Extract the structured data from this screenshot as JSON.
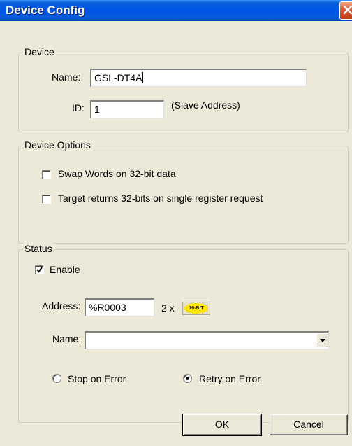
{
  "window": {
    "title": "Device Config"
  },
  "device": {
    "legend": "Device",
    "name_label": "Name:",
    "name_value": "GSL-DT4A",
    "id_label": "ID:",
    "id_value": "1",
    "id_hint": "(Slave Address)"
  },
  "options": {
    "legend": "Device Options",
    "swap_words_label": "Swap Words on 32-bit data",
    "swap_words_checked": false,
    "target32_label": "Target returns 32-bits on single register request",
    "target32_checked": false
  },
  "status": {
    "legend": "Status",
    "enable_label": "Enable",
    "enable_checked": true,
    "address_label": "Address:",
    "address_value": "%R0003",
    "multiplier": "2 x",
    "bit_badge": "16-BIT",
    "name_label": "Name:",
    "name_value": "",
    "stop_label": "Stop on Error",
    "retry_label": "Retry on Error",
    "selected_mode": "retry"
  },
  "buttons": {
    "ok": "OK",
    "cancel": "Cancel"
  },
  "colors": {
    "title_bar": "#0054e3",
    "dialog_bg": "#ece9d8",
    "badge": "#ffe400"
  }
}
